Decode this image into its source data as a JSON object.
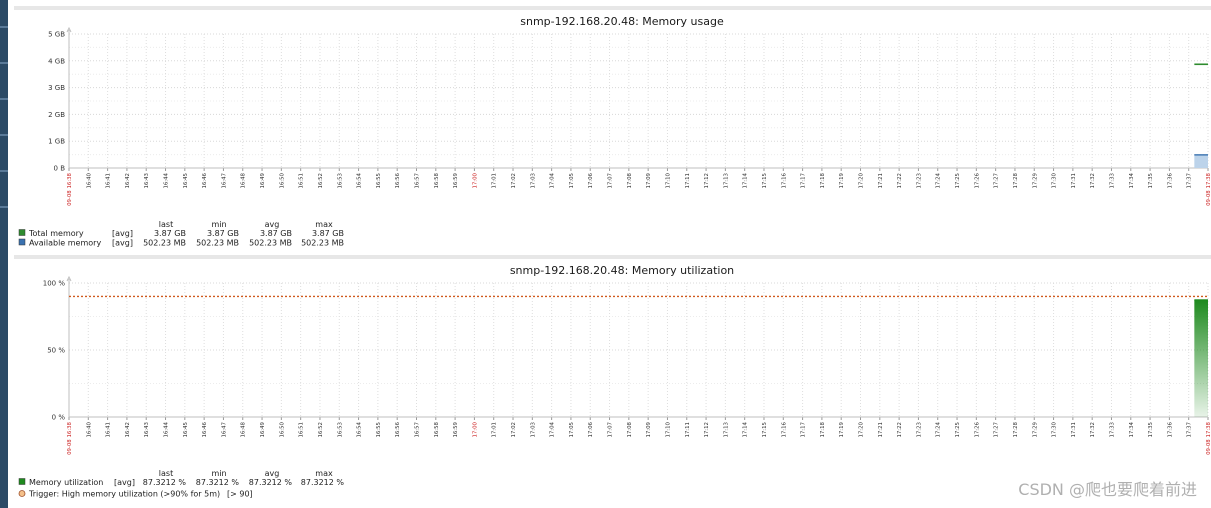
{
  "chart_data": [
    {
      "type": "area",
      "title": "snmp-192.168.20.48: Memory usage",
      "ylim_gb": [
        0,
        5
      ],
      "yticks": [
        "5 GB",
        "4 GB",
        "3 GB",
        "2 GB",
        "1 GB",
        "0 B"
      ],
      "ytick_values": [
        5,
        4,
        3,
        2,
        1,
        0
      ],
      "xticks": [
        "09-08 16:38",
        "16:40",
        "16:41",
        "16:42",
        "16:43",
        "16:44",
        "16:45",
        "16:46",
        "16:47",
        "16:48",
        "16:49",
        "16:50",
        "16:51",
        "16:52",
        "16:53",
        "16:54",
        "16:55",
        "16:56",
        "16:57",
        "16:58",
        "16:59",
        "17:00",
        "17:01",
        "17:02",
        "17:03",
        "17:04",
        "17:05",
        "17:06",
        "17:07",
        "17:08",
        "17:09",
        "17:10",
        "17:11",
        "17:12",
        "17:13",
        "17:14",
        "17:15",
        "17:16",
        "17:17",
        "17:18",
        "17:19",
        "17:20",
        "17:21",
        "17:22",
        "17:23",
        "17:24",
        "17:25",
        "17:26",
        "17:27",
        "17:28",
        "17:29",
        "17:30",
        "17:31",
        "17:32",
        "17:33",
        "17:34",
        "17:35",
        "17:36",
        "17:37",
        "09-08 17:38"
      ],
      "red_ticks": [
        "09-08 16:38",
        "17:00",
        "09-08 17:38"
      ],
      "legend_headers": [
        "last",
        "min",
        "avg",
        "max"
      ],
      "series": [
        {
          "name": "Total memory",
          "agg": "[avg]",
          "last": "3.87 GB",
          "min": "3.87 GB",
          "avg": "3.87 GB",
          "max": "3.87 GB",
          "value_gb": 3.87,
          "color": "#2e8b2e",
          "style": "line"
        },
        {
          "name": "Available memory",
          "agg": "[avg]",
          "last": "502.23 MB",
          "min": "502.23 MB",
          "avg": "502.23 MB",
          "max": "502.23 MB",
          "value_gb": 0.49,
          "color": "#3a72b0",
          "style": "area"
        }
      ],
      "data_start_fraction": 0.988
    },
    {
      "type": "area",
      "title": "snmp-192.168.20.48: Memory utilization",
      "ylim": [
        0,
        100
      ],
      "yticks": [
        "100 %",
        "50 %",
        "0 %"
      ],
      "ytick_values": [
        100,
        50,
        0
      ],
      "xticks": [
        "09-08 16:38",
        "16:40",
        "16:41",
        "16:42",
        "16:43",
        "16:44",
        "16:45",
        "16:46",
        "16:47",
        "16:48",
        "16:49",
        "16:50",
        "16:51",
        "16:52",
        "16:53",
        "16:54",
        "16:55",
        "16:56",
        "16:57",
        "16:58",
        "16:59",
        "17:00",
        "17:01",
        "17:02",
        "17:03",
        "17:04",
        "17:05",
        "17:06",
        "17:07",
        "17:08",
        "17:09",
        "17:10",
        "17:11",
        "17:12",
        "17:13",
        "17:14",
        "17:15",
        "17:16",
        "17:17",
        "17:18",
        "17:19",
        "17:20",
        "17:21",
        "17:22",
        "17:23",
        "17:24",
        "17:25",
        "17:26",
        "17:27",
        "17:28",
        "17:29",
        "17:30",
        "17:31",
        "17:32",
        "17:33",
        "17:34",
        "17:35",
        "17:36",
        "17:37",
        "09-08 17:38"
      ],
      "red_ticks": [
        "09-08 16:38",
        "17:00",
        "09-08 17:38"
      ],
      "legend_headers": [
        "last",
        "min",
        "avg",
        "max"
      ],
      "series": [
        {
          "name": "Memory utilization",
          "agg": "[avg]",
          "last": "87.3212 %",
          "min": "87.3212 %",
          "avg": "87.3212 %",
          "max": "87.3212 %",
          "value": 87.3212,
          "color": "#1e8a1e",
          "style": "area"
        }
      ],
      "trigger": {
        "label": "Trigger: High memory utilization (>90% for 5m)",
        "threshold_text": "[> 90]",
        "value": 90,
        "color": "#d05a1e"
      },
      "data_start_fraction": 0.988
    }
  ],
  "watermark": "CSDN @爬也要爬着前进"
}
